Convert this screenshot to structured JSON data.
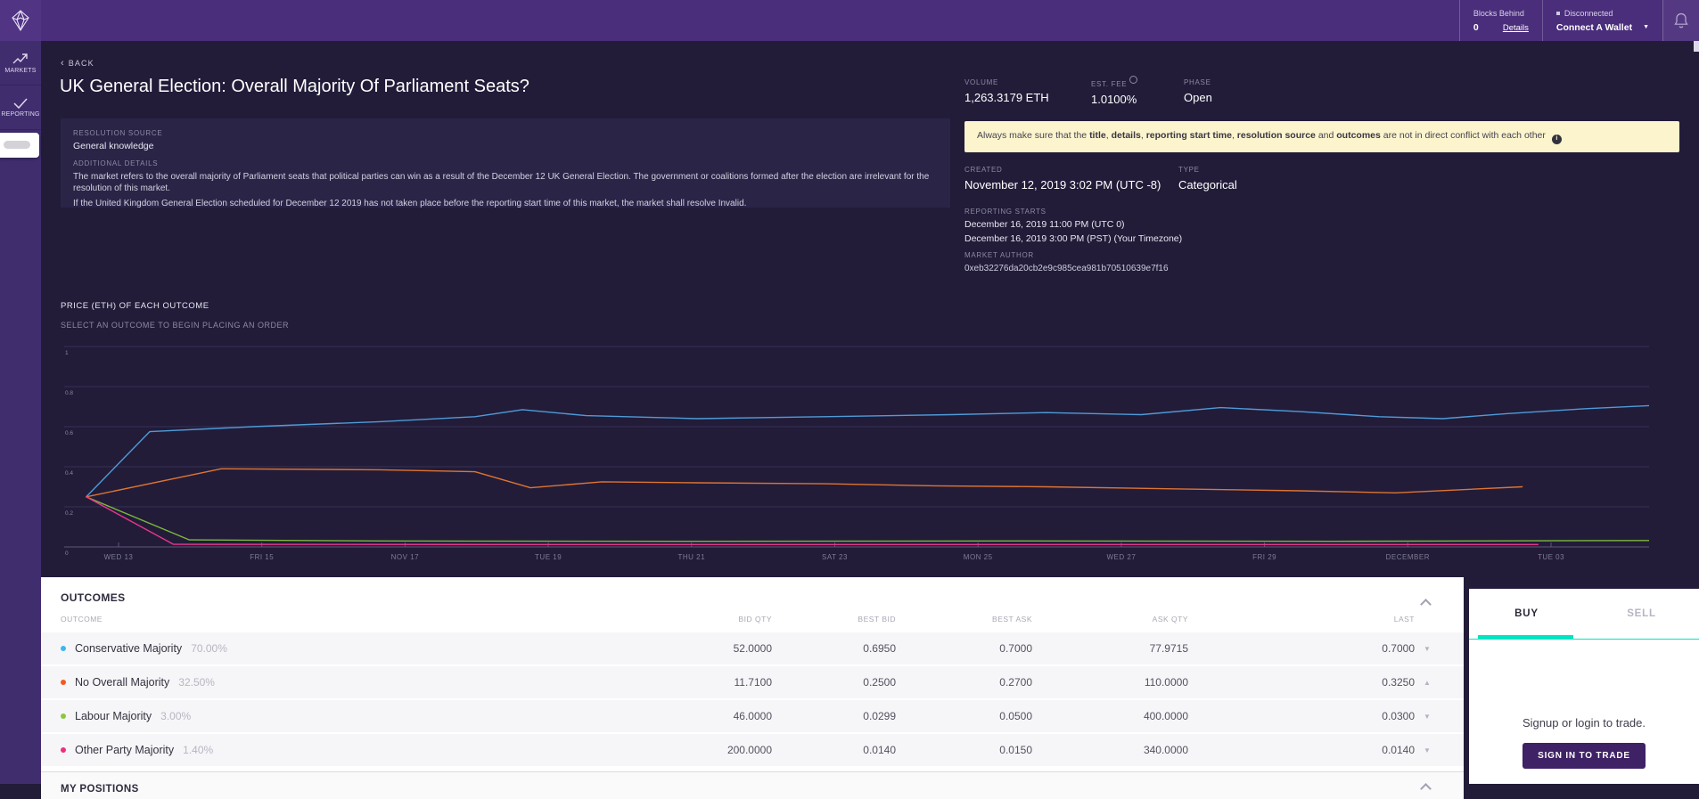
{
  "colors": {
    "topbar": "#4a2d7b",
    "sidebar": "#402d6e",
    "background": "#221c39",
    "panel": "#2a2447",
    "banner_bg": "#fbf4cd",
    "accent_teal": "#04e3c2",
    "button_purple": "#3f2165"
  },
  "topbar": {
    "blocks_behind_label": "Blocks Behind",
    "blocks_behind_value": "0",
    "details_link": "Details",
    "connection_status": "Disconnected",
    "connect_wallet_label": "Connect A Wallet",
    "logo_icon": "augur-logo",
    "bell_icon": "bell-icon"
  },
  "sidebar": {
    "items": [
      {
        "label": "MARKETS",
        "icon": "trending-up-icon"
      },
      {
        "label": "REPORTING",
        "icon": "checkmark-icon"
      }
    ]
  },
  "market": {
    "back_label": "BACK",
    "title": "UK General Election: Overall Majority Of Parliament Seats?",
    "resolution_source_label": "RESOLUTION SOURCE",
    "resolution_source": "General knowledge",
    "additional_details_label": "ADDITIONAL DETAILS",
    "details_paragraph_1": "The market refers to the overall majority of Parliament seats that political parties can win as a result of the December 12 UK General Election. The government or coalitions formed after the election are irrelevant for the resolution of this market.",
    "details_paragraph_2": "If the United Kingdom General Election scheduled for December 12 2019 has not taken place before the reporting start time of this market, the market shall resolve Invalid."
  },
  "stats": {
    "volume_label": "VOLUME",
    "volume_value": "1,263.3179 ETH",
    "fee_label": "EST. FEE",
    "fee_value": "1.0100%",
    "phase_label": "PHASE",
    "phase_value": "Open"
  },
  "banner": {
    "segments": [
      {
        "text": "Always make sure that the ",
        "bold": false
      },
      {
        "text": "title",
        "bold": true
      },
      {
        "text": ", ",
        "bold": false
      },
      {
        "text": "details",
        "bold": true
      },
      {
        "text": ", ",
        "bold": false
      },
      {
        "text": "reporting start time",
        "bold": true
      },
      {
        "text": ", ",
        "bold": false
      },
      {
        "text": "resolution source",
        "bold": true
      },
      {
        "text": " and ",
        "bold": false
      },
      {
        "text": "outcomes",
        "bold": true
      },
      {
        "text": " are not in direct conflict with each other",
        "bold": false
      }
    ]
  },
  "properties": {
    "created_label": "CREATED",
    "created_value": "November 12, 2019 3:02 PM (UTC -8)",
    "type_label": "TYPE",
    "type_value": "Categorical",
    "reporting_starts_label": "REPORTING STARTS",
    "reporting_starts_line1": "December 16, 2019 11:00 PM (UTC 0)",
    "reporting_starts_line2": "December 16, 2019 3:00 PM (PST) (Your Timezone)",
    "market_author_label": "MARKET AUTHOR",
    "market_author_value": "0xeb32276da20cb2e9c985cea981b70510639e7f16"
  },
  "chart_data": {
    "type": "line",
    "title": "PRICE (ETH) OF EACH OUTCOME",
    "subtitle": "SELECT AN OUTCOME TO BEGIN PLACING AN ORDER",
    "ylabel": "Price (ETH)",
    "ylim": [
      0,
      1
    ],
    "yticks": [
      1,
      0.8,
      0.6,
      0.4,
      0.2,
      0
    ],
    "grid": true,
    "legend": "none",
    "x_ticks": [
      "WED 13",
      "FRI 15",
      "NOV 17",
      "TUE 19",
      "THU 21",
      "SAT 23",
      "MON 25",
      "WED 27",
      "FRI 29",
      "DECEMBER",
      "TUE 03"
    ],
    "series": [
      {
        "name": "Conservative Majority",
        "color": "#4f9bd8",
        "points": [
          [
            1.5,
            0.25
          ],
          [
            5.5,
            0.575
          ],
          [
            12,
            0.6
          ],
          [
            20,
            0.625
          ],
          [
            26,
            0.65
          ],
          [
            29,
            0.685
          ],
          [
            33,
            0.655
          ],
          [
            40,
            0.64
          ],
          [
            48,
            0.65
          ],
          [
            56,
            0.66
          ],
          [
            62,
            0.67
          ],
          [
            68,
            0.66
          ],
          [
            73,
            0.695
          ],
          [
            78,
            0.675
          ],
          [
            83,
            0.65
          ],
          [
            87,
            0.64
          ],
          [
            91,
            0.665
          ],
          [
            96,
            0.69
          ],
          [
            100,
            0.705
          ]
        ]
      },
      {
        "name": "No Overall Majority",
        "color": "#dd7433",
        "points": [
          [
            1.5,
            0.25
          ],
          [
            10,
            0.39
          ],
          [
            20,
            0.385
          ],
          [
            26,
            0.375
          ],
          [
            29.5,
            0.295
          ],
          [
            34,
            0.325
          ],
          [
            40,
            0.32
          ],
          [
            48,
            0.315
          ],
          [
            55,
            0.305
          ],
          [
            62,
            0.3
          ],
          [
            70,
            0.29
          ],
          [
            78,
            0.28
          ],
          [
            84,
            0.27
          ],
          [
            88,
            0.285
          ],
          [
            92,
            0.3
          ]
        ]
      },
      {
        "name": "Labour Majority",
        "color": "#7cb93a",
        "points": [
          [
            1.5,
            0.25
          ],
          [
            8,
            0.035
          ],
          [
            20,
            0.03
          ],
          [
            40,
            0.028
          ],
          [
            60,
            0.03
          ],
          [
            80,
            0.028
          ],
          [
            100,
            0.032
          ]
        ]
      },
      {
        "name": "Other Party Majority",
        "color": "#e5368c",
        "points": [
          [
            1.5,
            0.25
          ],
          [
            7,
            0.013
          ],
          [
            30,
            0.012
          ],
          [
            60,
            0.012
          ],
          [
            93,
            0.012
          ]
        ]
      }
    ]
  },
  "outcomes": {
    "title": "OUTCOMES",
    "columns": [
      "OUTCOME",
      "BID QTY",
      "BEST BID",
      "BEST ASK",
      "ASK QTY",
      "LAST"
    ],
    "rows": [
      {
        "name": "Conservative Majority",
        "percent": "70.00%",
        "dot": "#3fb5f0",
        "bid_qty": "52.0000",
        "best_bid": "0.6950",
        "best_ask": "0.7000",
        "ask_qty": "77.9715",
        "last": "0.7000",
        "trend": "down"
      },
      {
        "name": "No Overall Majority",
        "percent": "32.50%",
        "dot": "#f4591e",
        "bid_qty": "11.7100",
        "best_bid": "0.2500",
        "best_ask": "0.2700",
        "ask_qty": "110.0000",
        "last": "0.3250",
        "trend": "up"
      },
      {
        "name": "Labour Majority",
        "percent": "3.00%",
        "dot": "#8dc63f",
        "bid_qty": "46.0000",
        "best_bid": "0.0299",
        "best_ask": "0.0500",
        "ask_qty": "400.0000",
        "last": "0.0300",
        "trend": "down"
      },
      {
        "name": "Other Party Majority",
        "percent": "1.40%",
        "dot": "#ee2f7d",
        "bid_qty": "200.0000",
        "best_bid": "0.0140",
        "best_ask": "0.0150",
        "ask_qty": "340.0000",
        "last": "0.0140",
        "trend": "down"
      }
    ]
  },
  "positions": {
    "title": "MY POSITIONS"
  },
  "trade_panel": {
    "buy_tab": "BUY",
    "sell_tab": "SELL",
    "signup_text": "Signup or login to trade.",
    "sign_in_button": "SIGN IN TO TRADE"
  }
}
